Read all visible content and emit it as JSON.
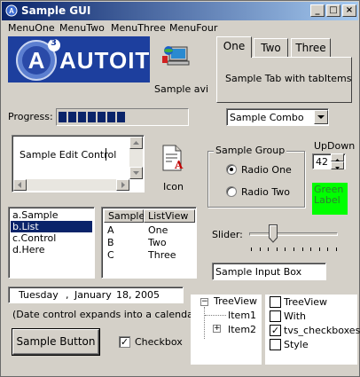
{
  "window": {
    "title": "Sample GUI"
  },
  "menu": [
    "MenuOne",
    "MenuTwo",
    "MenuThree",
    "MenuFour"
  ],
  "logo": {
    "text": "AUTOIT",
    "badge": "3"
  },
  "avi_label": "Sample avi",
  "tabs": {
    "items": [
      "One",
      "Two",
      "Three"
    ],
    "content": "Sample Tab with tabItems"
  },
  "progress": {
    "label": "Progress:",
    "value": 0.5
  },
  "combo": {
    "value": "Sample Combo"
  },
  "edit": {
    "value": "Sample Edit Control"
  },
  "icon_label": "Icon",
  "group": {
    "title": "Sample Group",
    "radios": [
      "Radio One",
      "Radio Two"
    ],
    "selected": 0
  },
  "updown": {
    "label": "UpDown",
    "value": "42"
  },
  "green_label": {
    "text": "Green Label",
    "color": "#00ff00"
  },
  "list": {
    "items": [
      "a.Sample",
      "b.List",
      "c.Control",
      "d.Here"
    ],
    "selected": 1
  },
  "listview": {
    "headers": [
      "Sample",
      "ListView"
    ],
    "rows": [
      [
        "A",
        "One"
      ],
      [
        "B",
        "Two"
      ],
      [
        "C",
        "Three"
      ]
    ]
  },
  "slider": {
    "label": "Slider:",
    "value": 0.27
  },
  "input": {
    "value": "Sample Input Box"
  },
  "date": {
    "day": "Tuesday",
    "month": "January",
    "date": "18, 2005",
    "sep": ",",
    "note": "(Date control expands into a calendar)"
  },
  "button": {
    "label": "Sample Button"
  },
  "checkbox": {
    "label": "Checkbox",
    "checked": true
  },
  "tree": {
    "root": "TreeView",
    "children": [
      "Item1",
      "Item2"
    ],
    "root_toggle": "−",
    "child_toggle": "+"
  },
  "tree_checks": {
    "items": [
      "TreeView",
      "With",
      "tvs_checkboxes",
      "Style"
    ],
    "checked_index": 2
  },
  "check_mark": "✓",
  "title_buttons": {
    "minimize": "_",
    "maximize": "□",
    "close": "×"
  }
}
